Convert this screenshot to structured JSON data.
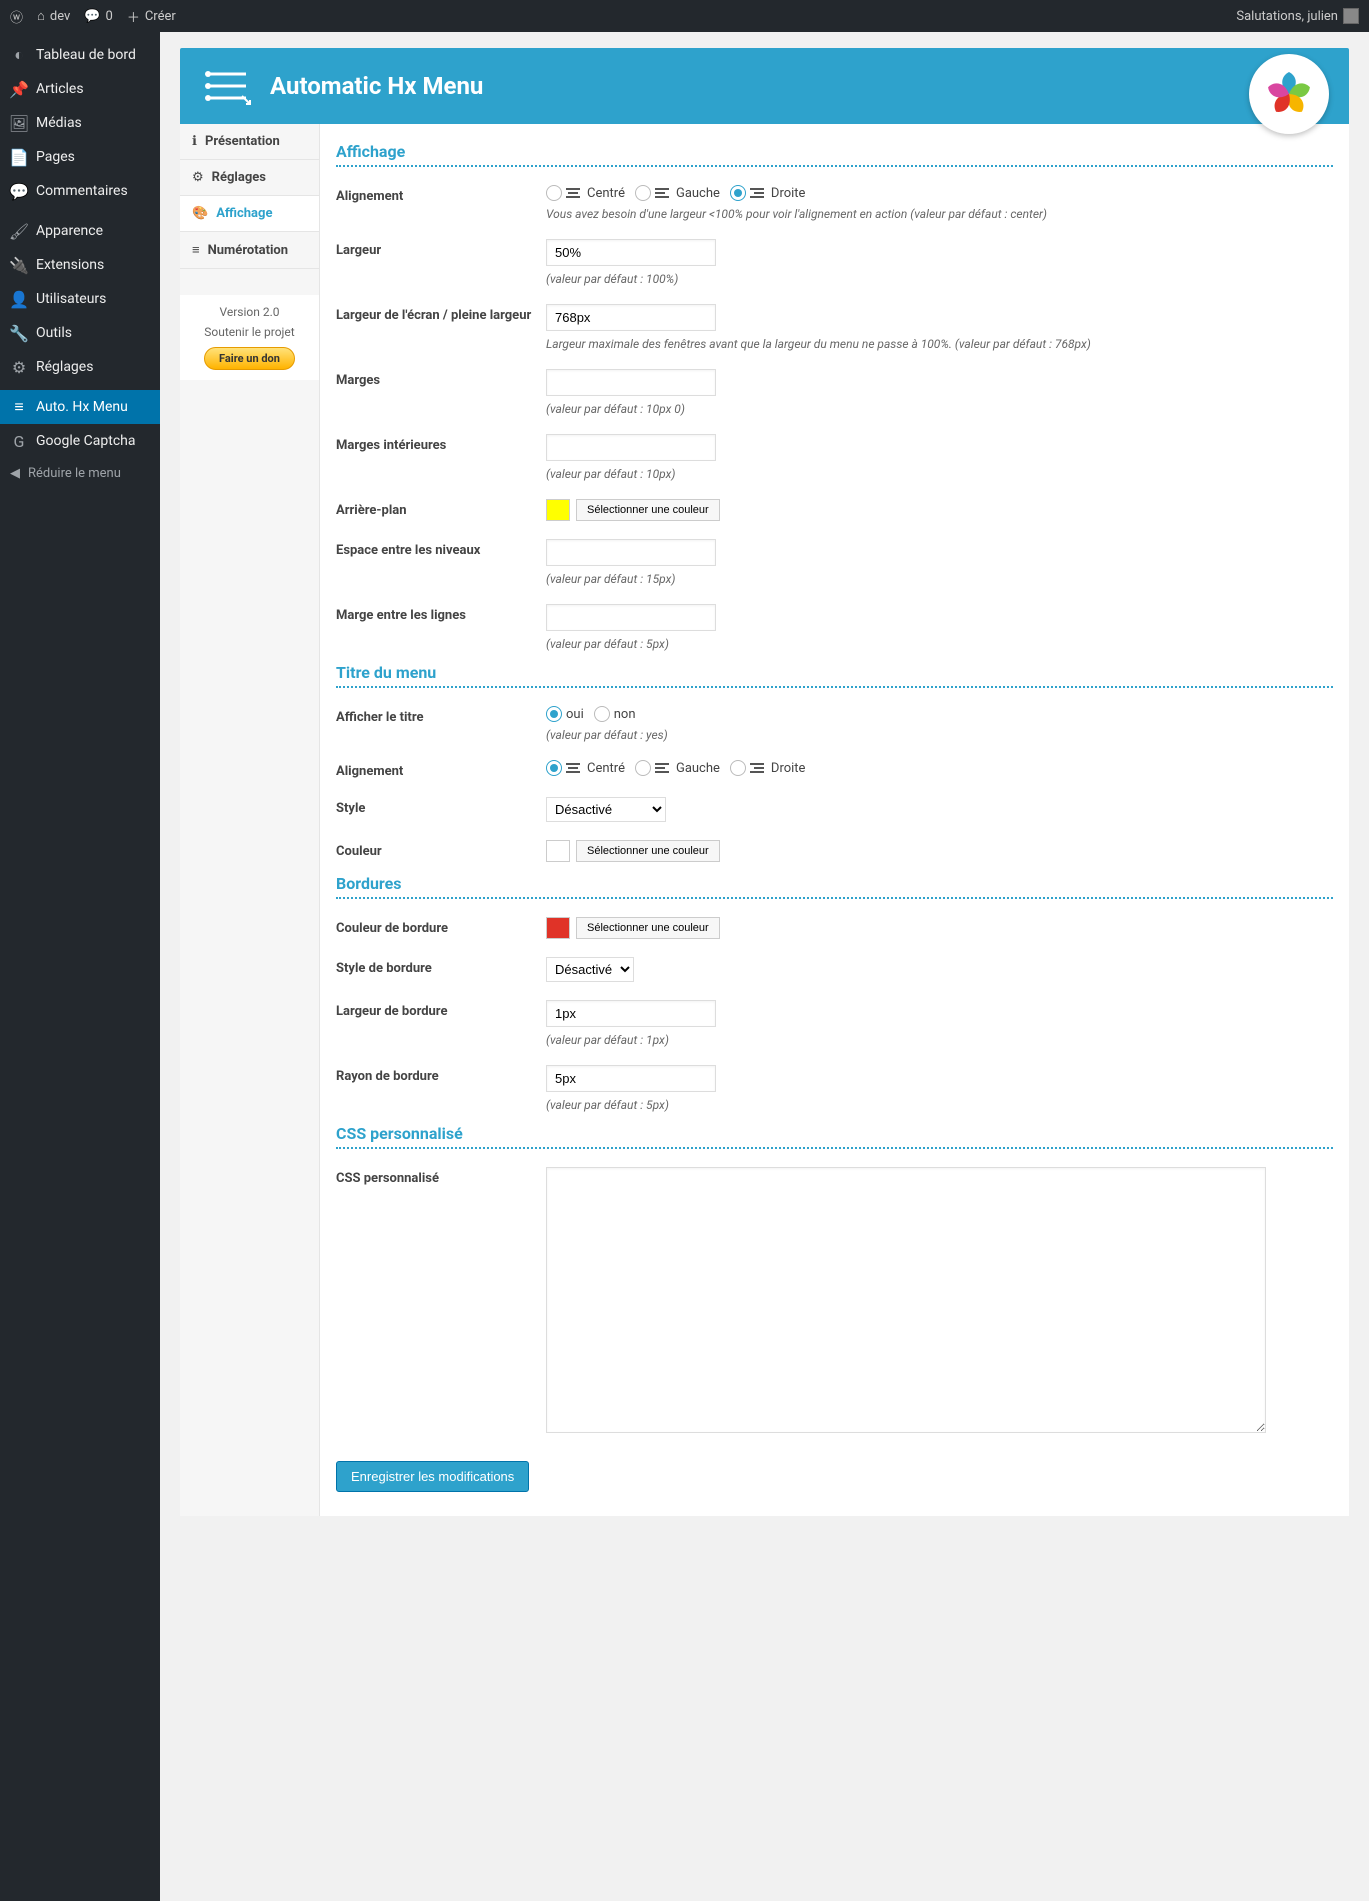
{
  "adminbar": {
    "site": "dev",
    "comments": "0",
    "create": "Créer",
    "greeting": "Salutations, julien"
  },
  "sidebar": {
    "items": [
      {
        "icon": "◐",
        "label": "Tableau de bord"
      },
      {
        "icon": "📌",
        "label": "Articles"
      },
      {
        "icon": "🖼",
        "label": "Médias"
      },
      {
        "icon": "📄",
        "label": "Pages"
      },
      {
        "icon": "💬",
        "label": "Commentaires"
      },
      {
        "icon": "🖌",
        "label": "Apparence"
      },
      {
        "icon": "🔌",
        "label": "Extensions"
      },
      {
        "icon": "👤",
        "label": "Utilisateurs"
      },
      {
        "icon": "🔧",
        "label": "Outils"
      },
      {
        "icon": "⚙",
        "label": "Réglages"
      },
      {
        "icon": "≡",
        "label": "Auto. Hx Menu",
        "active": true
      },
      {
        "icon": "G",
        "label": "Google Captcha"
      }
    ],
    "collapse": "Réduire le menu"
  },
  "banner": {
    "title": "Automatic Hx Menu"
  },
  "subnav": {
    "items": [
      {
        "icon": "ℹ",
        "label": "Présentation"
      },
      {
        "icon": "⚙",
        "label": "Réglages"
      },
      {
        "icon": "🎨",
        "label": "Affichage",
        "active": true
      },
      {
        "icon": "≡",
        "label": "Numérotation"
      }
    ],
    "version": "Version 2.0",
    "support": "Soutenir le projet",
    "donate": "Faire un don"
  },
  "sections": {
    "affichage": "Affichage",
    "titremenu": "Titre du menu",
    "bordures": "Bordures",
    "css": "CSS personnalisé"
  },
  "form": {
    "align": {
      "label": "Alignement",
      "centre": "Centré",
      "gauche": "Gauche",
      "droite": "Droite",
      "hint": "Vous avez besoin d'une largeur <100% pour voir l'alignement en action (valeur par défaut : center)"
    },
    "largeur": {
      "label": "Largeur",
      "value": "50%",
      "hint": "(valeur par défaut : 100%)"
    },
    "largeurEcran": {
      "label": "Largeur de l'écran / pleine largeur",
      "value": "768px",
      "hint": "Largeur maximale des fenêtres avant que la largeur du menu ne passe à 100%. (valeur par défaut : 768px)"
    },
    "marges": {
      "label": "Marges",
      "value": "",
      "hint": "(valeur par défaut : 10px 0)"
    },
    "margesInt": {
      "label": "Marges intérieures",
      "value": "",
      "hint": "(valeur par défaut : 10px)"
    },
    "arriere": {
      "label": "Arrière-plan",
      "color": "#ffff00",
      "btn": "Sélectionner une couleur"
    },
    "espace": {
      "label": "Espace entre les niveaux",
      "value": "",
      "hint": "(valeur par défaut : 15px)"
    },
    "margeLignes": {
      "label": "Marge entre les lignes",
      "value": "",
      "hint": "(valeur par défaut : 5px)"
    },
    "afficherTitre": {
      "label": "Afficher le titre",
      "oui": "oui",
      "non": "non",
      "hint": "(valeur par défaut : yes)"
    },
    "titleAlign": {
      "label": "Alignement",
      "centre": "Centré",
      "gauche": "Gauche",
      "droite": "Droite"
    },
    "style": {
      "label": "Style",
      "value": "Désactivé"
    },
    "couleur": {
      "label": "Couleur",
      "color": "#ffffff",
      "btn": "Sélectionner une couleur"
    },
    "bordColor": {
      "label": "Couleur de bordure",
      "color": "#e03328",
      "btn": "Sélectionner une couleur"
    },
    "bordStyle": {
      "label": "Style de bordure",
      "value": "Désactivé"
    },
    "bordWidth": {
      "label": "Largeur de bordure",
      "value": "1px",
      "hint": "(valeur par défaut : 1px)"
    },
    "bordRadius": {
      "label": "Rayon de bordure",
      "value": "5px",
      "hint": "(valeur par défaut : 5px)"
    },
    "customCSS": {
      "label": "CSS personnalisé"
    },
    "submit": "Enregistrer les modifications"
  }
}
